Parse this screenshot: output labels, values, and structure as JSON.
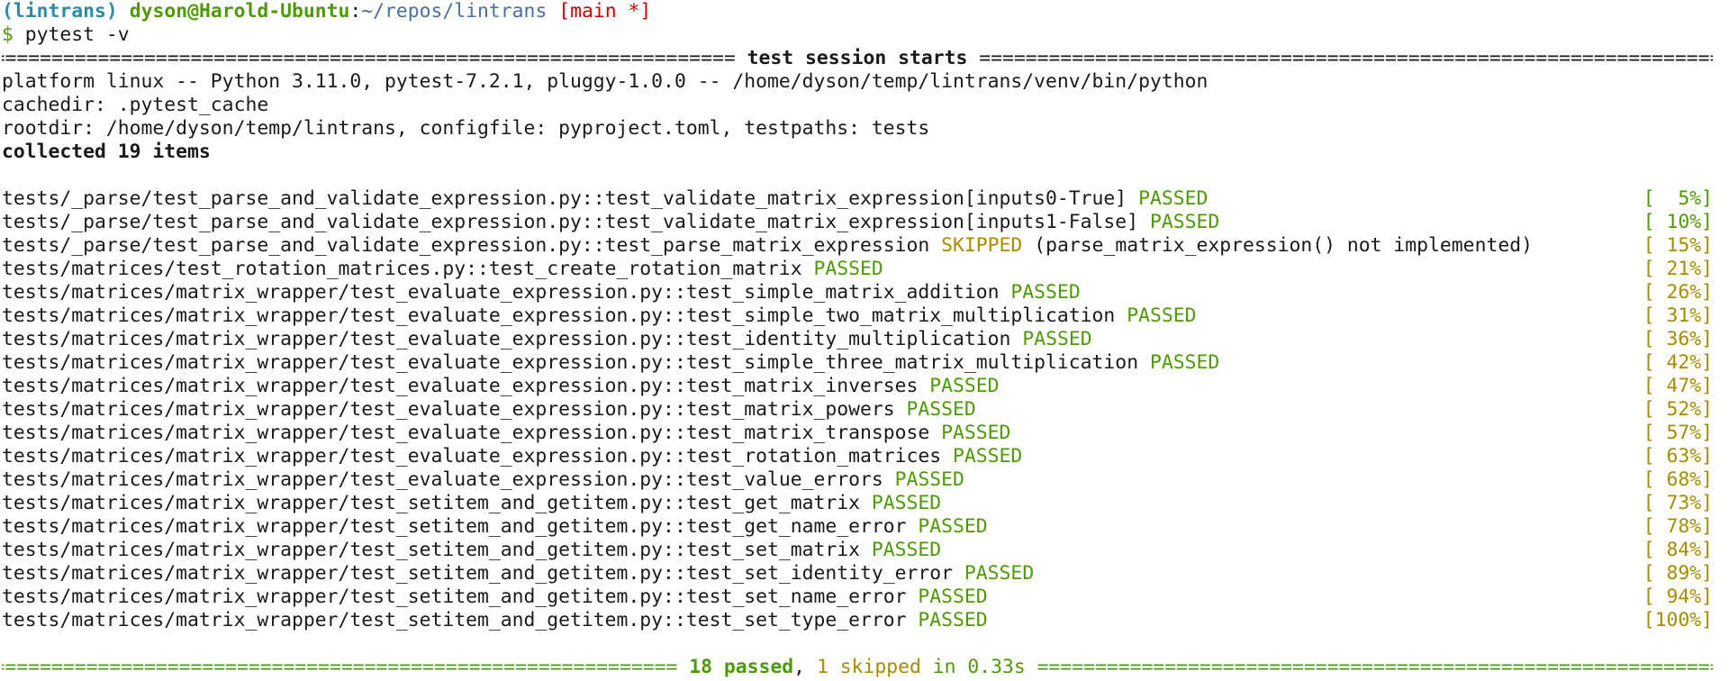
{
  "prompt": {
    "venv": "(lintrans)",
    "user_host": "dyson@Harold-Ubuntu",
    "colon": ":",
    "path": "~/repos/lintrans",
    "branch": "[main *]",
    "dollar": "$",
    "command": " pytest -v"
  },
  "session_header": {
    "title": " test session starts ",
    "rule_char": "="
  },
  "info_lines": [
    "platform linux -- Python 3.11.0, pytest-7.2.1, pluggy-1.0.0 -- /home/dyson/temp/lintrans/venv/bin/python",
    "cachedir: .pytest_cache",
    "rootdir: /home/dyson/temp/lintrans, configfile: pyproject.toml, testpaths: tests"
  ],
  "collected": "collected 19 items",
  "tests": [
    {
      "name": "tests/_parse/test_parse_and_validate_expression.py::test_validate_matrix_expression[inputs0-True]",
      "status": "PASSED",
      "reason": "",
      "progress": "[  5%]"
    },
    {
      "name": "tests/_parse/test_parse_and_validate_expression.py::test_validate_matrix_expression[inputs1-False]",
      "status": "PASSED",
      "reason": "",
      "progress": "[ 10%]"
    },
    {
      "name": "tests/_parse/test_parse_and_validate_expression.py::test_parse_matrix_expression",
      "status": "SKIPPED",
      "reason": " (parse_matrix_expression() not implemented)",
      "progress": "[ 15%]"
    },
    {
      "name": "tests/matrices/test_rotation_matrices.py::test_create_rotation_matrix",
      "status": "PASSED",
      "reason": "",
      "progress": "[ 21%]"
    },
    {
      "name": "tests/matrices/matrix_wrapper/test_evaluate_expression.py::test_simple_matrix_addition",
      "status": "PASSED",
      "reason": "",
      "progress": "[ 26%]"
    },
    {
      "name": "tests/matrices/matrix_wrapper/test_evaluate_expression.py::test_simple_two_matrix_multiplication",
      "status": "PASSED",
      "reason": "",
      "progress": "[ 31%]"
    },
    {
      "name": "tests/matrices/matrix_wrapper/test_evaluate_expression.py::test_identity_multiplication",
      "status": "PASSED",
      "reason": "",
      "progress": "[ 36%]"
    },
    {
      "name": "tests/matrices/matrix_wrapper/test_evaluate_expression.py::test_simple_three_matrix_multiplication",
      "status": "PASSED",
      "reason": "",
      "progress": "[ 42%]"
    },
    {
      "name": "tests/matrices/matrix_wrapper/test_evaluate_expression.py::test_matrix_inverses",
      "status": "PASSED",
      "reason": "",
      "progress": "[ 47%]"
    },
    {
      "name": "tests/matrices/matrix_wrapper/test_evaluate_expression.py::test_matrix_powers",
      "status": "PASSED",
      "reason": "",
      "progress": "[ 52%]"
    },
    {
      "name": "tests/matrices/matrix_wrapper/test_evaluate_expression.py::test_matrix_transpose",
      "status": "PASSED",
      "reason": "",
      "progress": "[ 57%]"
    },
    {
      "name": "tests/matrices/matrix_wrapper/test_evaluate_expression.py::test_rotation_matrices",
      "status": "PASSED",
      "reason": "",
      "progress": "[ 63%]"
    },
    {
      "name": "tests/matrices/matrix_wrapper/test_evaluate_expression.py::test_value_errors",
      "status": "PASSED",
      "reason": "",
      "progress": "[ 68%]"
    },
    {
      "name": "tests/matrices/matrix_wrapper/test_setitem_and_getitem.py::test_get_matrix",
      "status": "PASSED",
      "reason": "",
      "progress": "[ 73%]"
    },
    {
      "name": "tests/matrices/matrix_wrapper/test_setitem_and_getitem.py::test_get_name_error",
      "status": "PASSED",
      "reason": "",
      "progress": "[ 78%]"
    },
    {
      "name": "tests/matrices/matrix_wrapper/test_setitem_and_getitem.py::test_set_matrix",
      "status": "PASSED",
      "reason": "",
      "progress": "[ 84%]"
    },
    {
      "name": "tests/matrices/matrix_wrapper/test_setitem_and_getitem.py::test_set_identity_error",
      "status": "PASSED",
      "reason": "",
      "progress": "[ 89%]"
    },
    {
      "name": "tests/matrices/matrix_wrapper/test_setitem_and_getitem.py::test_set_name_error",
      "status": "PASSED",
      "reason": "",
      "progress": "[ 94%]"
    },
    {
      "name": "tests/matrices/matrix_wrapper/test_setitem_and_getitem.py::test_set_type_error",
      "status": "PASSED",
      "reason": "",
      "progress": "[100%]"
    }
  ],
  "summary": {
    "passed": " 18 passed",
    "sep": ", ",
    "skipped": "1 skipped",
    "time": " in 0.33s "
  },
  "colors": {
    "background": "#ffffff",
    "text": "#1a1a1a",
    "green": "#4e9a06",
    "amber": "#a88b00",
    "red": "#cc0000",
    "cyan": "#2a8ca8",
    "blue": "#4a6fa5"
  }
}
